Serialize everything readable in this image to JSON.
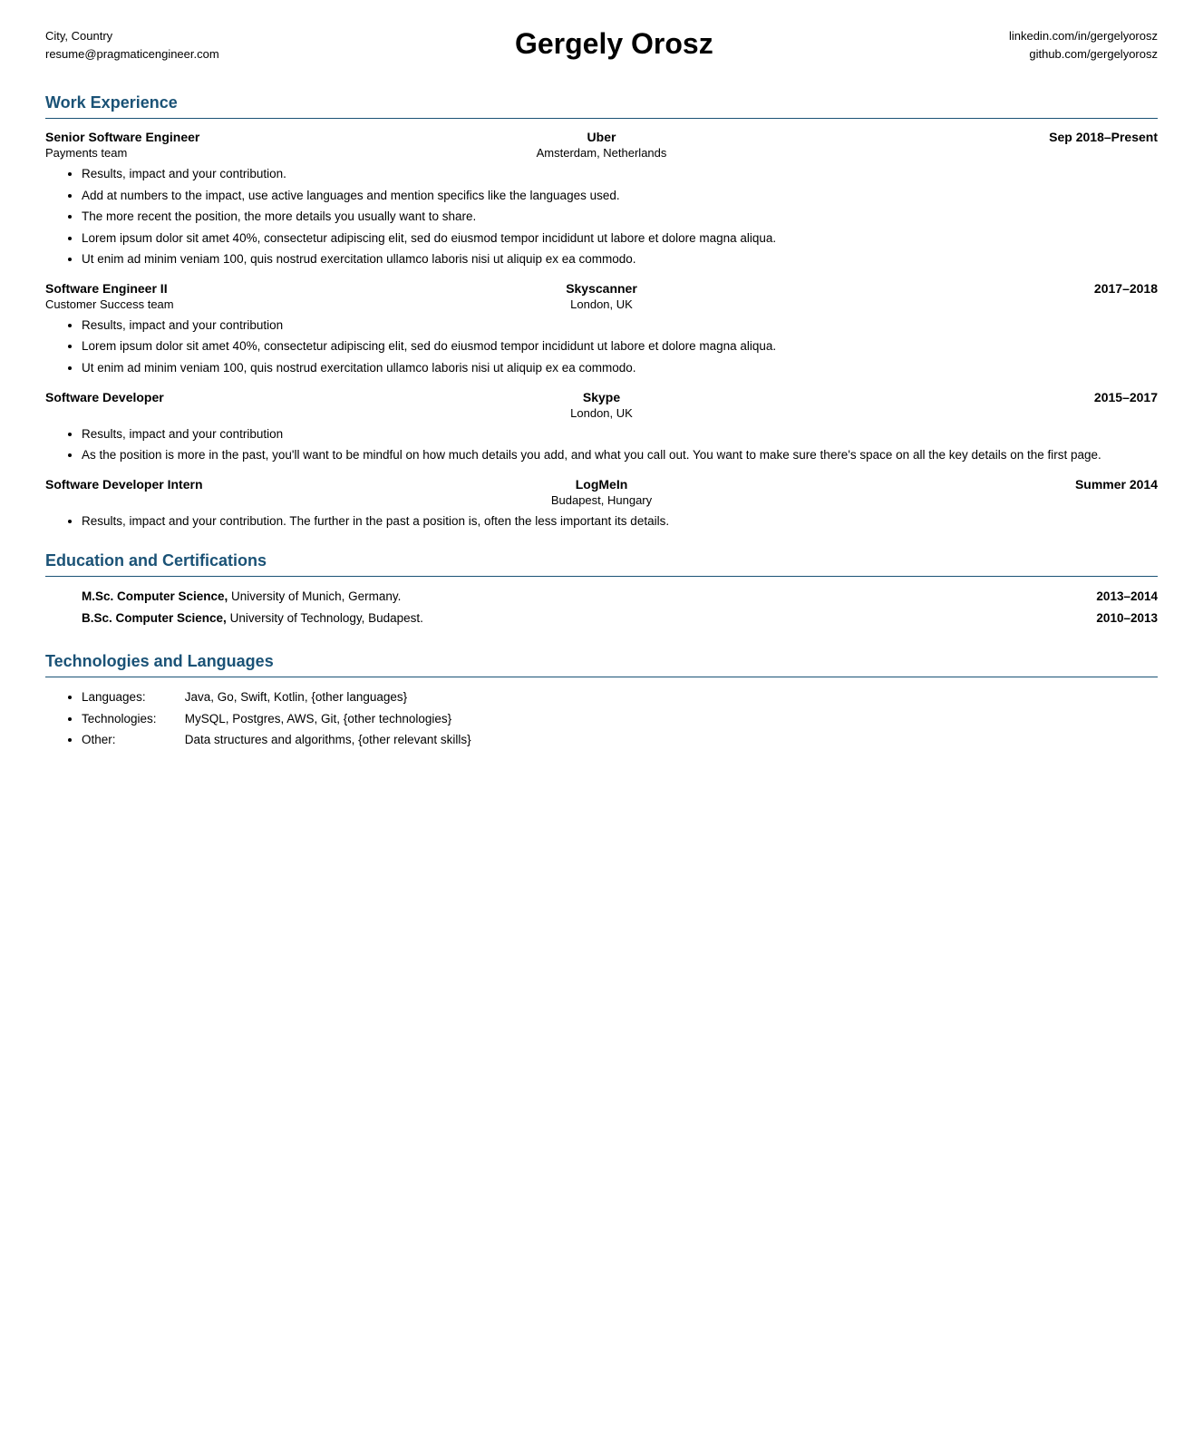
{
  "header": {
    "left_line1": "City, Country",
    "left_line2": "resume@pragmaticengineer.com",
    "name": "Gergely Orosz",
    "right_line1": "linkedin.com/in/gergelyorosz",
    "right_line2": "github.com/gergelyorosz"
  },
  "work_experience": {
    "section_title": "Work Experience",
    "jobs": [
      {
        "title": "Senior Software Engineer",
        "company": "Uber",
        "date": "Sep 2018–Present",
        "team": "Payments team",
        "location": "Amsterdam, Netherlands",
        "bullets": [
          "Results, impact and your contribution.",
          "Add at numbers to the impact, use active languages and mention specifics like the languages used.",
          "The more recent the position, the more details you usually want to share.",
          "Lorem ipsum dolor sit amet 40%, consectetur adipiscing elit, sed do eiusmod tempor incididunt ut labore et dolore magna aliqua.",
          "Ut enim ad minim veniam 100, quis nostrud exercitation ullamco laboris nisi ut aliquip ex ea commodo."
        ]
      },
      {
        "title": "Software Engineer II",
        "company": "Skyscanner",
        "date": "2017–2018",
        "team": "Customer Success team",
        "location": "London, UK",
        "bullets": [
          "Results, impact and your contribution",
          "Lorem ipsum dolor sit amet 40%, consectetur adipiscing elit, sed do eiusmod tempor incididunt ut labore et dolore magna aliqua.",
          "Ut enim ad minim veniam 100, quis nostrud exercitation ullamco laboris nisi ut aliquip ex ea commodo."
        ]
      },
      {
        "title": "Software Developer",
        "company": "Skype",
        "date": "2015–2017",
        "team": "",
        "location": "London, UK",
        "bullets": [
          "Results, impact and your contribution",
          "As the position is more in the past, you'll want to be mindful on how much details you add, and what you call out. You want to make sure there's space on all the key details on the first page."
        ]
      },
      {
        "title": "Software Developer Intern",
        "company": "LogMeIn",
        "date": "Summer 2014",
        "team": "",
        "location": "Budapest, Hungary",
        "bullets": [
          "Results, impact and your contribution. The further in the past a position is, often the less important its details."
        ]
      }
    ]
  },
  "education": {
    "section_title": "Education and Certifications",
    "items": [
      {
        "text": "M.Sc. Computer Science, University of Munich, Germany.",
        "bold_part": "M.Sc. Computer Science,",
        "date": "2013–2014"
      },
      {
        "text": "B.Sc. Computer Science, University of Technology, Budapest.",
        "bold_part": "B.Sc. Computer Science,",
        "date": "2010–2013"
      },
      {
        "text": "",
        "date": ""
      }
    ]
  },
  "technologies": {
    "section_title": "Technologies and Languages",
    "items": [
      {
        "label": "Languages:",
        "value": "Java, Go, Swift, Kotlin, {other languages}"
      },
      {
        "label": "Technologies:",
        "value": "MySQL, Postgres, AWS, Git, {other technologies}"
      },
      {
        "label": "Other:",
        "value": "Data structures and algorithms, {other relevant skills}"
      }
    ]
  }
}
